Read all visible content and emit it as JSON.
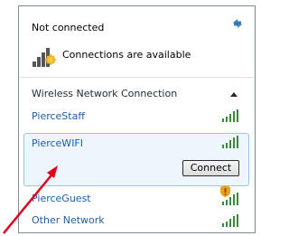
{
  "status": {
    "title": "Not connected",
    "text": "Connections are available"
  },
  "icons": {
    "refresh": "refresh-icon",
    "status": "network-status-warning-icon",
    "collapse": "chevron-up-icon",
    "signal": "signal-strength-icon",
    "shield": "security-shield-icon",
    "pointer": "red-arrow-annotation"
  },
  "section": {
    "label": "Wireless Network Connection"
  },
  "networks": [
    {
      "name": "PierceStaff"
    },
    {
      "name": "PierceWIFI",
      "action_label": "Connect"
    },
    {
      "name": "PierceGuest"
    },
    {
      "name": "Other Network"
    }
  ],
  "colors": {
    "link": "#1e5ea8",
    "signal": "#3a8a3a",
    "selection_bg": "#eef5fc",
    "selection_border": "#9fc3e7",
    "annotation_arrow": "#e0001b"
  }
}
